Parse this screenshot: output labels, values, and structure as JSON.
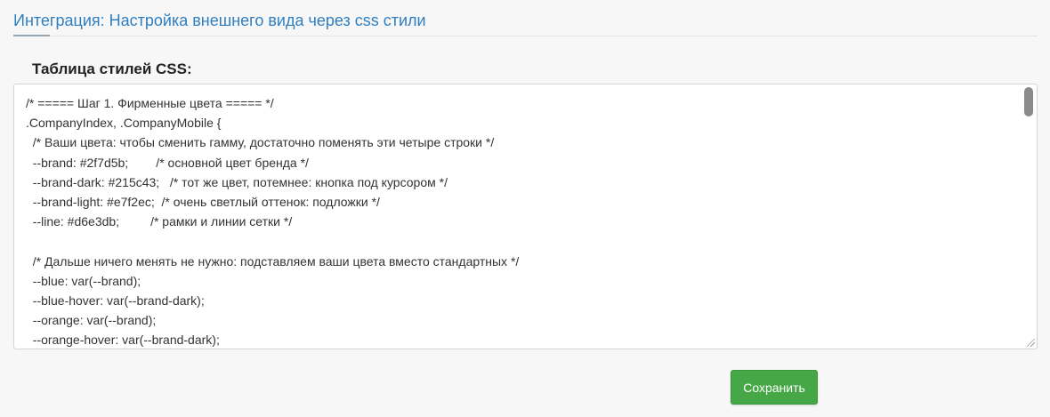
{
  "header": {
    "title": "Интеграция: Настройка внешнего вида через css стили"
  },
  "editor": {
    "label": "Таблица стилей CSS:",
    "value": "/* ===== Шаг 1. Фирменные цвета ===== */\n.CompanyIndex, .CompanyMobile {\n  /* Ваши цвета: чтобы сменить гамму, достаточно поменять эти четыре строки */\n  --brand: #2f7d5b;        /* основной цвет бренда */\n  --brand-dark: #215c43;   /* тот же цвет, потемнее: кнопка под курсором */\n  --brand-light: #e7f2ec;  /* очень светлый оттенок: подложки */\n  --line: #d6e3db;         /* рамки и линии сетки */\n\n  /* Дальше ничего менять не нужно: подставляем ваши цвета вместо стандартных */\n  --blue: var(--brand);\n  --blue-hover: var(--brand-dark);\n  --orange: var(--brand);\n  --orange-hover: var(--brand-dark);"
  },
  "actions": {
    "save_label": "Сохранить"
  },
  "colors": {
    "title": "#2f7fc0",
    "button": "#46a746"
  }
}
